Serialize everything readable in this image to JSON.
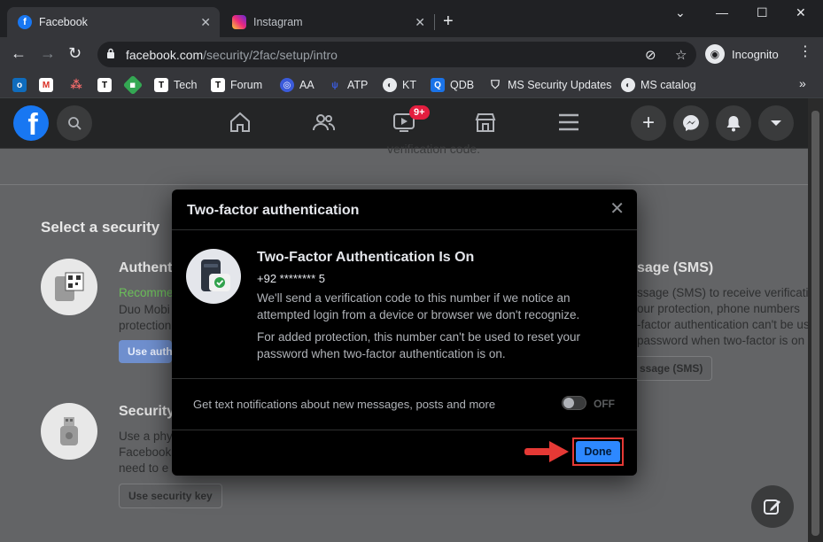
{
  "browser": {
    "tabs": [
      {
        "title": "Facebook",
        "active": true
      },
      {
        "title": "Instagram",
        "active": false
      }
    ],
    "url_host": "facebook.com",
    "url_path": "/security/2fac/setup/intro",
    "incognito_label": "Incognito",
    "bookmarks": [
      {
        "label": "",
        "icon": "outlook-icon"
      },
      {
        "label": "",
        "icon": "gmail-icon"
      },
      {
        "label": "",
        "icon": "asana-icon"
      },
      {
        "label": "",
        "icon": "tech-t-icon"
      },
      {
        "label": "",
        "icon": "green-diamond-icon"
      },
      {
        "label": "Tech",
        "icon": "tech-t-icon"
      },
      {
        "label": "Forum",
        "icon": "tech-t-icon"
      },
      {
        "label": "AA",
        "icon": "eye-icon"
      },
      {
        "label": "ATP",
        "icon": "wolf-icon"
      },
      {
        "label": "KT",
        "icon": "globe-icon"
      },
      {
        "label": "QDB",
        "icon": "q-icon"
      },
      {
        "label": "MS Security Updates",
        "icon": "shield-icon"
      },
      {
        "label": "MS catalog",
        "icon": "globe-icon"
      }
    ],
    "colors": {
      "chrome_bg": "#202124",
      "toolbar_bg": "#35363a"
    }
  },
  "facebook_nav": {
    "notification_badge": "9+"
  },
  "background_page": {
    "top_text": "verification code.",
    "section_title": "Select a security",
    "option_auth_app": {
      "title": "Authent",
      "recommended": "Recomme",
      "desc_line1": "Duo Mobi",
      "desc_line2": "protection",
      "button": "Use auth"
    },
    "option_sms": {
      "title": "sage (SMS)",
      "desc_line1": "ssage (SMS) to receive verificati",
      "desc_line2": "our protection, phone numbers",
      "desc_line3": "-factor authentication can't be us",
      "desc_line4": "password when two-factor is on",
      "button": "ssage (SMS)"
    },
    "option_key": {
      "title": "Security",
      "desc_line1": "Use a phy",
      "desc_line2": "Facebook",
      "desc_line3": "need to e",
      "button": "Use security key"
    }
  },
  "modal": {
    "title": "Two-factor authentication",
    "heading": "Two-Factor Authentication Is On",
    "phone": "+92 ********  5",
    "paragraph1": "We'll send a verification code to this number if we notice an attempted login from a device or browser we don't recognize.",
    "paragraph2": "For added protection, this number can't be used to reset your password when two-factor authentication is on.",
    "notification_label": "Get text notifications about new messages, posts and more",
    "toggle_state": "OFF",
    "done_label": "Done",
    "colors": {
      "done_bg": "#2d88ff",
      "highlight": "#e53935"
    }
  }
}
